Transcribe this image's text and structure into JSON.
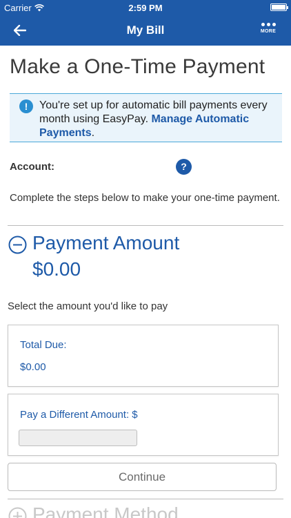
{
  "status_bar": {
    "carrier": "Carrier",
    "time": "2:59 PM"
  },
  "nav": {
    "title": "My Bill",
    "more_label": "MORE"
  },
  "page": {
    "title": "Make a One-Time Payment"
  },
  "banner": {
    "text": "You're set up for automatic bill payments every month using EasyPay.",
    "link": "Manage Automatic Payments",
    "suffix": "."
  },
  "account": {
    "label": "Account:",
    "help": "?"
  },
  "steps_text": "Complete the steps below to make your one-time payment.",
  "payment_amount": {
    "title": "Payment Amount",
    "amount": "$0.00",
    "select_label": "Select the amount you'd like to pay",
    "total_due_label": "Total Due:",
    "total_due_value": "$0.00",
    "different_label": "Pay a Different Amount: $",
    "different_value": ""
  },
  "continue_label": "Continue",
  "next_section": {
    "title": "Payment Method"
  },
  "colors": {
    "brand": "#1e5aa8",
    "info": "#2a8fd1",
    "banner_bg": "#eaf4fb"
  },
  "icons": [
    "wifi-icon",
    "battery-icon",
    "back-arrow-icon",
    "more-icon",
    "info-icon",
    "help-icon",
    "collapse-icon",
    "expand-icon"
  ]
}
